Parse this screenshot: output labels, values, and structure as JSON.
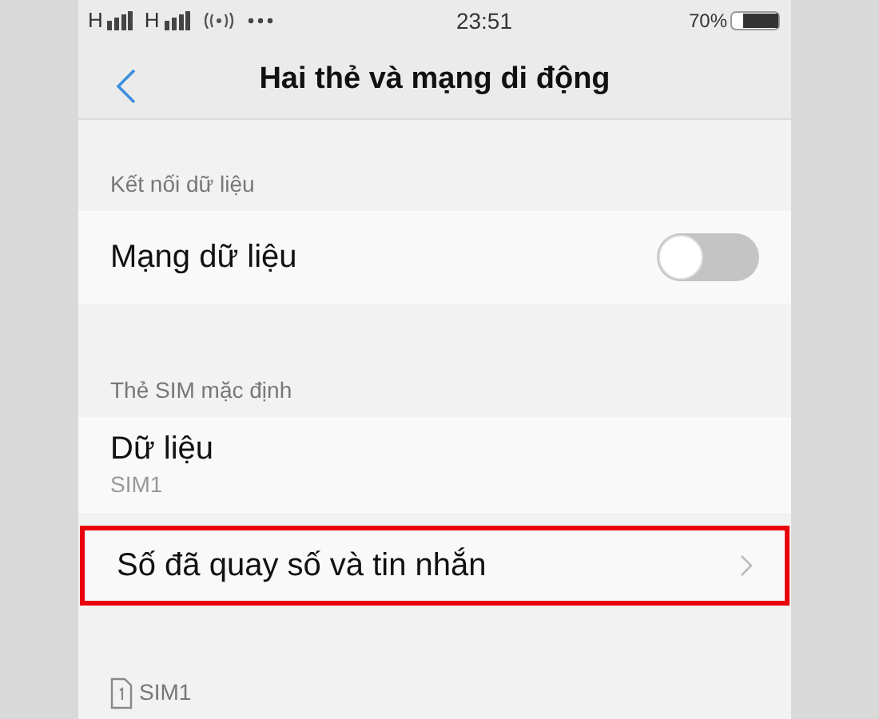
{
  "status_bar": {
    "network_1": "H",
    "network_2": "H",
    "time": "23:51",
    "battery": "70%"
  },
  "header": {
    "title": "Hai thẻ và mạng di động"
  },
  "sections": [
    {
      "title": "Kết nối dữ liệu",
      "items": [
        {
          "kind": "toggle",
          "label": "Mạng dữ liệu",
          "on": false
        }
      ]
    },
    {
      "title": "Thẻ SIM mặc định",
      "items": [
        {
          "kind": "value",
          "label": "Dữ liệu",
          "value": "SIM1"
        },
        {
          "kind": "link",
          "label": "Số đã quay số và tin nhắn",
          "highlighted": true
        }
      ]
    },
    {
      "title": "SIM1",
      "sim_icon": true
    }
  ]
}
